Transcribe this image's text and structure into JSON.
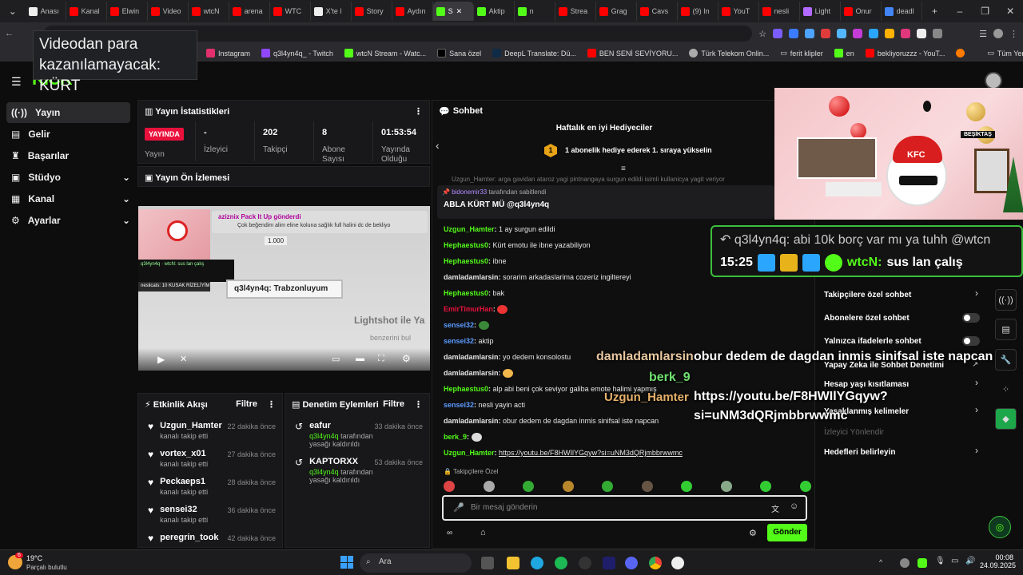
{
  "browser": {
    "tabs": [
      "Anası",
      "Kanal",
      "Elwin",
      "Video",
      "wtcN",
      "arena",
      "WTC",
      "X'te l",
      "Story",
      "Aydın",
      "S",
      "Aktip",
      "n",
      "Strea",
      "Grag",
      "Cavs",
      "(9) In",
      "YouT",
      "nesli",
      "Light",
      "Onur",
      "deadl"
    ],
    "bookmarks": [
      "Instagram",
      "q3l4yn4q_ - Twitch",
      "wtcN Stream - Watc...",
      "Sana özel",
      "DeepL Translate: Dü...",
      "BEN SENİ SEVİYORU...",
      "Türk Telekom Onlin...",
      "ferit klipler",
      "en",
      "bekliyoruzzz - YouT...",
      "Tüm Yer İşaretleri"
    ],
    "tooltip": "Videodan para kazanılamayacak: KÜRT"
  },
  "sidebar": {
    "logo": "KICK",
    "items": [
      {
        "label": "Yayın",
        "icon": "broadcast-icon"
      },
      {
        "label": "Gelir",
        "icon": "revenue-icon"
      },
      {
        "label": "Başarılar",
        "icon": "trophy-icon"
      },
      {
        "label": "Stüdyo",
        "icon": "studio-icon"
      },
      {
        "label": "Kanal",
        "icon": "channel-icon"
      },
      {
        "label": "Ayarlar",
        "icon": "gear-icon"
      }
    ]
  },
  "stats": {
    "title": "Yayın İstatistikleri",
    "live": "YAYINDA",
    "live_label": "Yayın",
    "viewers_value": "-",
    "viewers_label": "İzleyici",
    "followers_value": "202",
    "followers_label": "Takipçi",
    "subs_value": "8",
    "subs_label": "Abone Sayısı",
    "uptime_value": "01:53:54",
    "uptime_label": "Yayında Olduğu"
  },
  "preview": {
    "title": "Yayın Ön İzlemesi",
    "banner": "aziznix Pack It Up gönderdi",
    "subline": "Çok beğendim alim eline koluna sağlık full halini dc de bekliyo",
    "overlay_msg": "q3l4yn4q: Trabzonluyum",
    "tool_text": "Lightshot ile Ya",
    "tool_sub": "benzerini bul",
    "chip": "neslicats: 10 KUSAK RİZELİYİM",
    "coin": "1.000"
  },
  "activity": {
    "title": "Etkinlik Akışı",
    "filter": "Filtre",
    "items": [
      {
        "name": "Uzgun_Hamter",
        "sub": "kanalı takip etti",
        "time": "22 dakika önce"
      },
      {
        "name": "vortex_x01",
        "sub": "kanalı takip etti",
        "time": "27 dakika önce"
      },
      {
        "name": "Peckaeps1",
        "sub": "kanalı takip etti",
        "time": "28 dakika önce"
      },
      {
        "name": "sensei32",
        "sub": "kanalı takip etti",
        "time": "36 dakika önce"
      },
      {
        "name": "peregrin_took",
        "sub": "",
        "time": "42 dakika önce"
      }
    ]
  },
  "moderation": {
    "title": "Denetim Eylemleri",
    "filter": "Filtre",
    "items": [
      {
        "name": "eafur",
        "by": "q3l4yn4q",
        "action": "tarafından yasağı kaldırıldı",
        "time": "33 dakika önce"
      },
      {
        "name": "KAPTORXX",
        "by": "q3l4yn4q",
        "action": "tarafından yasağı kaldırıldı",
        "time": "53 dakika önce"
      }
    ]
  },
  "chat": {
    "title": "Sohbet",
    "top_gifters": "Haftalık en iyi Hediyeciler",
    "gift_rank": "1",
    "gift_cta": "1 abonelik hediye ederek 1. sıraya yükselin",
    "pinned_by": "bidonemir33",
    "pinned_suffix": "tarafından sabitlendi",
    "pinned_text": "ABLA KÜRT MÜ @q3l4yn4q",
    "cutoff": "Uzgun_Hamter: arga gavidan ataroz yagi pintnangaya surgun edildi isimli kullanicya yagit veriyor",
    "messages": [
      {
        "user": "Uzgun_Hamter",
        "color": "#53fc18",
        "text": "1 ay surgun edildi"
      },
      {
        "user": "Hephaestus0",
        "color": "#53fc18",
        "text": "Kürt emotu ile ibne yazabiliyon"
      },
      {
        "user": "Hephaestus0",
        "color": "#53fc18",
        "text": "                              ibne"
      },
      {
        "user": "damladamlarsin",
        "color": "#e6e6e6",
        "text": "sorarim arkadaslarima cozeriz ingiltereyi"
      },
      {
        "user": "Hephaestus0",
        "color": "#53fc18",
        "text": "bak"
      },
      {
        "user": "EmirTimurHan",
        "color": "#e9113c",
        "text": ""
      },
      {
        "user": "sensei32",
        "color": "#5b9bff",
        "text": ""
      },
      {
        "user": "sensei32",
        "color": "#5b9bff",
        "text": "aktip"
      },
      {
        "user": "damladamlarsin",
        "color": "#e6e6e6",
        "text": "yo dedem konsolostu"
      },
      {
        "user": "damladamlarsin",
        "color": "#e6e6e6",
        "text": ""
      },
      {
        "user": "Hephaestus0",
        "color": "#53fc18",
        "text": "alp abi beni çok seviyor galiba emote halimi yapmış"
      },
      {
        "user": "sensei32",
        "color": "#5b9bff",
        "text": "nesli yayin acti"
      },
      {
        "user": "damladamlarsin",
        "color": "#e6e6e6",
        "text": "obur dedem de dagdan inmis sinifsal iste napcan"
      },
      {
        "user": "berk_9",
        "color": "#53fc18",
        "text": ""
      },
      {
        "user": "Uzgun_Hamter",
        "color": "#53fc18",
        "text": "https://youtu.be/F8HWIlYGqyw?si=uNM3dQRjmbbrwwmc"
      }
    ],
    "followers_only_tag": "Takipçilere Özel",
    "input_placeholder": "Bir mesaj gönderin",
    "send": "Gönder"
  },
  "chat_settings": {
    "items": [
      {
        "label": "Takipçilere özel sohbet",
        "kind": "chevron"
      },
      {
        "label": "Abonelere özel sohbet",
        "kind": "toggle"
      },
      {
        "label": "Yalnızca ifadelerle sohbet",
        "kind": "toggle"
      },
      {
        "label": "Yapay Zeka ile Sohbet Denetimi",
        "kind": "external"
      },
      {
        "label": "Hesap yaşı kısıtlaması",
        "kind": "chevron"
      },
      {
        "label": "Yasaklanmış kelimeler",
        "kind": "chevron"
      },
      {
        "label": "İzleyici Yönlendir",
        "kind": "disabled"
      },
      {
        "label": "Hedefleri belirleyin",
        "kind": "chevron"
      }
    ]
  },
  "overlay": {
    "big_reply": "q3l4yn4q: abi 10k borç var mı ya tuhh @wtcn",
    "big_time": "15:25",
    "big_user": "wtcN:",
    "big_text": "sus lan çalış",
    "float_user1": "damladamlarsin",
    "float_text1": "obur dedem de dagdan inmis sinifsal iste napcan",
    "float_user2": "berk_9",
    "float_user3": "Uzgun_Hamter",
    "float_text3a": "https://youtu.be/F8HWIlYGqyw?",
    "float_text3b": "si=uNM3dQRjmbbrwwmc",
    "cam_tag": "BEŞİKTAŞ",
    "kfc": "KFC"
  },
  "taskbar": {
    "weather_temp": "19°C",
    "weather_desc": "Parçalı bulutlu",
    "weather_badge": "6",
    "search": "Ara",
    "time": "00:08",
    "date": "24.09.2025"
  }
}
